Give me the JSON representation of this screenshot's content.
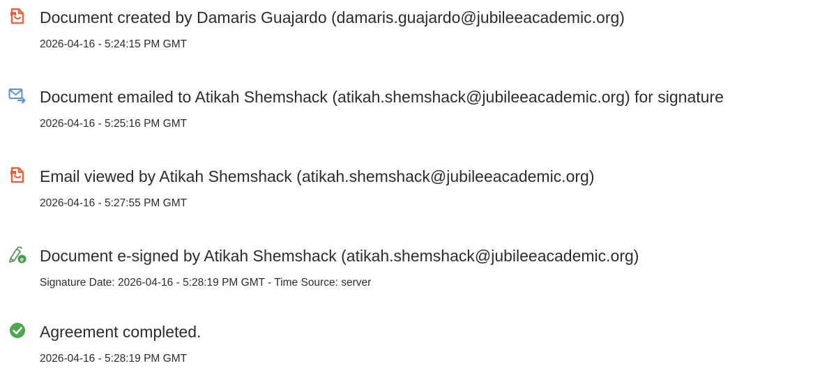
{
  "colors": {
    "doc_icon": "#e8603c",
    "email_icon": "#5b8fd6",
    "esign_icon": "#4a9a52",
    "complete_icon": "#4aa84f",
    "text": "#2c2c2c"
  },
  "events": [
    {
      "icon": "document-icon",
      "title": "Document created by Damaris Guajardo (damaris.guajardo@jubileeacademic.org)",
      "detail": "2026-04-16 - 5:24:15 PM GMT"
    },
    {
      "icon": "email-send-icon",
      "title": "Document emailed to Atikah Shemshack (atikah.shemshack@jubileeacademic.org) for signature",
      "detail": "2026-04-16 - 5:25:16 PM GMT"
    },
    {
      "icon": "document-icon",
      "title": "Email viewed by Atikah Shemshack (atikah.shemshack@jubileeacademic.org)",
      "detail": "2026-04-16 - 5:27:55 PM GMT"
    },
    {
      "icon": "esign-pen-icon",
      "title": "Document e-signed by Atikah Shemshack (atikah.shemshack@jubileeacademic.org)",
      "detail": "Signature Date: 2026-04-16 - 5:28:19 PM GMT - Time Source: server"
    },
    {
      "icon": "check-circle-icon",
      "title": "Agreement completed.",
      "detail": "2026-04-16 - 5:28:19 PM GMT"
    }
  ]
}
